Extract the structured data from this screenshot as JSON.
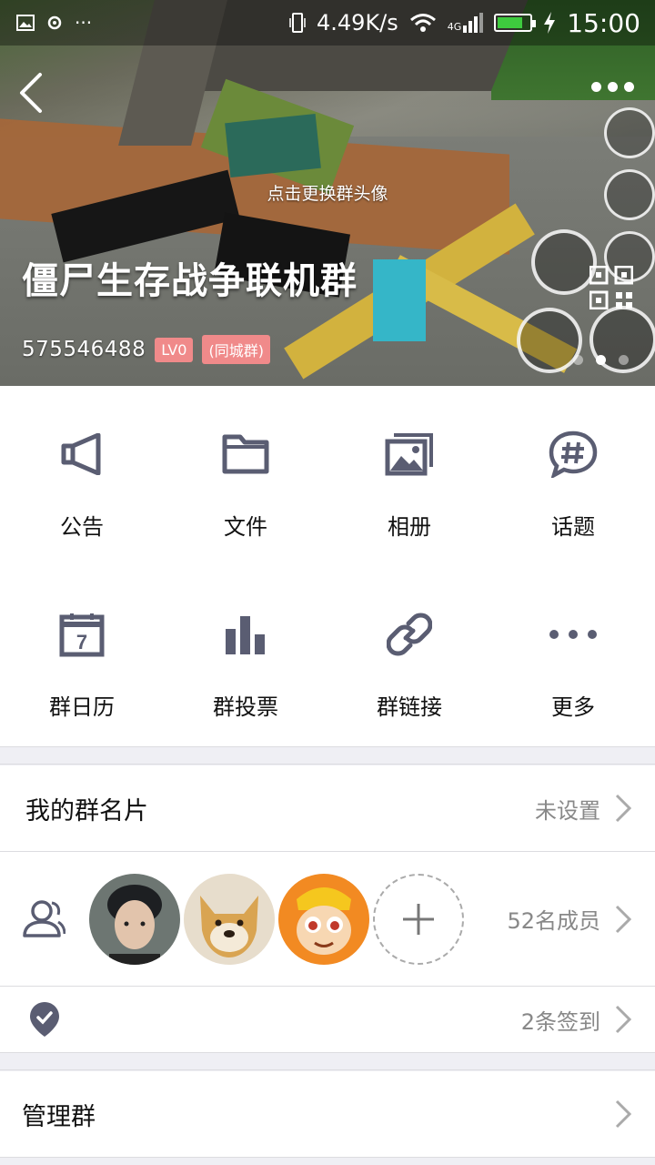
{
  "status_bar": {
    "speed": "4.49K/s",
    "network": "4G",
    "time": "15:00",
    "battery_level": 0.8
  },
  "header": {
    "change_avatar_hint": "点击更换群头像",
    "group_name": "僵尸生存战争联机群",
    "group_id": "575546488",
    "level_badge": "LV0",
    "city_badge": "(同城群)"
  },
  "features": [
    {
      "label": "公告",
      "icon": "announcement-icon"
    },
    {
      "label": "文件",
      "icon": "folder-icon"
    },
    {
      "label": "相册",
      "icon": "album-icon"
    },
    {
      "label": "话题",
      "icon": "topic-icon"
    },
    {
      "label": "群日历",
      "icon": "calendar-icon",
      "day": "7"
    },
    {
      "label": "群投票",
      "icon": "vote-icon"
    },
    {
      "label": "群链接",
      "icon": "link-icon"
    },
    {
      "label": "更多",
      "icon": "more-icon"
    }
  ],
  "rows": {
    "card_title": "我的群名片",
    "card_value": "未设置",
    "members_value": "52名成员",
    "checkin_value": "2条签到",
    "manage_title": "管理群"
  },
  "colors": {
    "icon": "#5a5d72",
    "badge": "#f08a8a",
    "value_text": "#888888"
  }
}
